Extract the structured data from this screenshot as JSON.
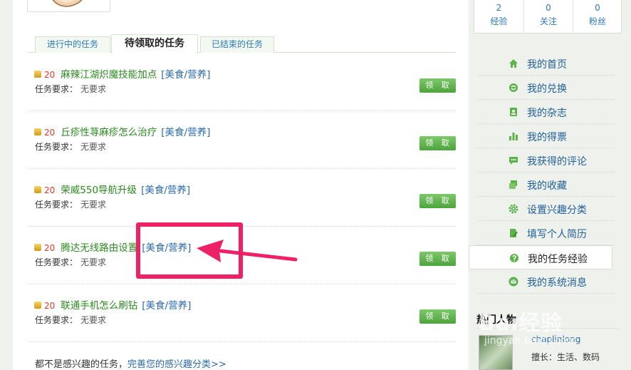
{
  "tabs": [
    "进行中的任务",
    "待领取的任务",
    "已结束的任务"
  ],
  "tasks": [
    {
      "points": "20",
      "title": "麻辣江湖炽魔技能加点",
      "category": "[美食/营养]",
      "req_label": "任务要求：",
      "req_value": "无要求",
      "claim": "领 取"
    },
    {
      "points": "20",
      "title": "丘疹性荨麻疹怎么治疗",
      "category": "[美食/营养]",
      "req_label": "任务要求：",
      "req_value": "无要求",
      "claim": "领 取"
    },
    {
      "points": "20",
      "title": "荣威550导航升级",
      "category": "[美食/营养]",
      "req_label": "任务要求：",
      "req_value": "无要求",
      "claim": "领 取"
    },
    {
      "points": "20",
      "title": "腾达无线路由设置",
      "category": "[美食/营养]",
      "req_label": "任务要求：",
      "req_value": "无要求",
      "claim": "领 取"
    },
    {
      "points": "20",
      "title": "联通手机怎么刷钻",
      "category": "[美食/营养]",
      "req_label": "任务要求：",
      "req_value": "无要求",
      "claim": "领 取"
    }
  ],
  "bottom": {
    "text": "都不是感兴趣的任务，",
    "link": "完善您的感兴趣分类>>"
  },
  "stats": [
    {
      "value": "2",
      "label": "经验"
    },
    {
      "value": "0",
      "label": "关注"
    },
    {
      "value": "0",
      "label": "粉丝"
    }
  ],
  "menu": [
    {
      "label": "我的首页",
      "icon": "home-icon"
    },
    {
      "label": "我的兑换",
      "icon": "exchange-icon"
    },
    {
      "label": "我的杂志",
      "icon": "magazine-icon"
    },
    {
      "label": "我的得票",
      "icon": "chart-icon"
    },
    {
      "label": "我获得的评论",
      "icon": "comment-icon"
    },
    {
      "label": "我的收藏",
      "icon": "collect-icon"
    },
    {
      "label": "设置兴趣分类",
      "icon": "gear-icon"
    },
    {
      "label": "填写个人简历",
      "icon": "edit-icon"
    },
    {
      "label": "我的任务经验",
      "icon": "task-icon",
      "active": true
    },
    {
      "label": "我的系统消息",
      "icon": "mail-icon"
    }
  ],
  "hot": {
    "title": "热门人物",
    "name": "chaplinlong",
    "skill": "擅长：生活、数码"
  },
  "watermark": {
    "brand": "Bai经验",
    "site": "jingyan.baidu.com"
  },
  "colors": {
    "accent": "#2a8a1e",
    "link": "#2a6aa8",
    "annotation": "#ee2167",
    "button": "#5cb349"
  }
}
